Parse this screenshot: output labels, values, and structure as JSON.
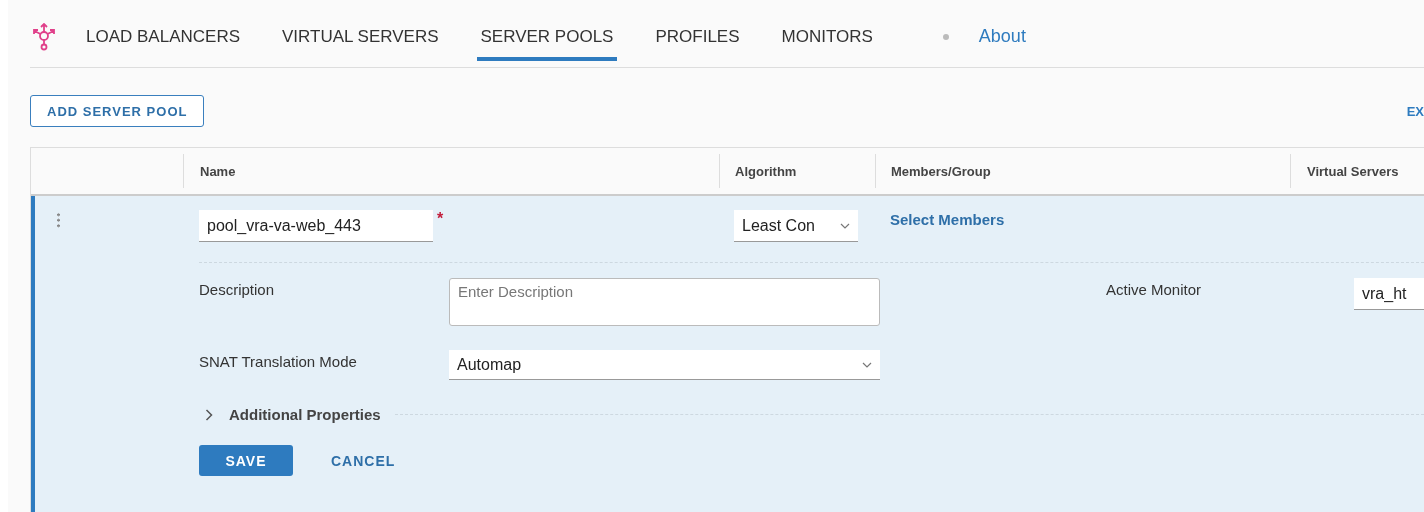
{
  "nav": {
    "tabs": [
      {
        "label": "LOAD BALANCERS",
        "selected": false
      },
      {
        "label": "VIRTUAL SERVERS",
        "selected": false
      },
      {
        "label": "SERVER POOLS",
        "selected": true
      },
      {
        "label": "PROFILES",
        "selected": false
      },
      {
        "label": "MONITORS",
        "selected": false
      }
    ],
    "about": "About"
  },
  "toolbar": {
    "add_button": "ADD SERVER POOL",
    "export_link": "EX"
  },
  "table": {
    "columns": [
      "Name",
      "Algorithm",
      "Members/Group",
      "Virtual Servers"
    ],
    "edit_row": {
      "name_value": "pool_vra-va-web_443",
      "required_mark": "*",
      "algorithm": "Least Con",
      "members_link": "Select Members",
      "description_label": "Description",
      "description_placeholder": "Enter Description",
      "monitor_label": "Active Monitor",
      "monitor_value": "vra_ht",
      "snat_label": "SNAT Translation Mode",
      "snat_value": "Automap",
      "additional": {
        "label": "Additional Properties",
        "expanded": false
      },
      "save": "SAVE",
      "cancel": "CANCEL"
    }
  }
}
